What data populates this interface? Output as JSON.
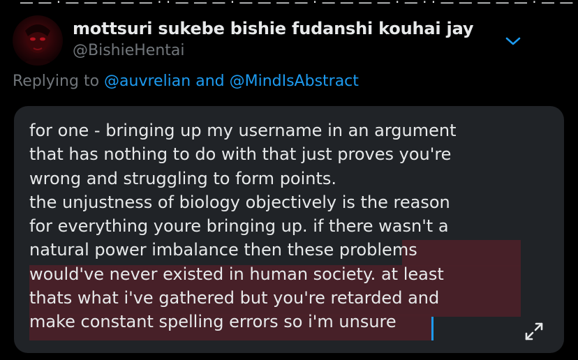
{
  "colors": {
    "background": "#000000",
    "card": "#202327",
    "text": "#e7e9ea",
    "muted": "#71767b",
    "link": "#1d9bf0",
    "highlight": "#4a2128"
  },
  "tweet": {
    "author": {
      "display_name": "mottsuri sukebe bishie fudanshi kouhai jay",
      "handle": "@BishieHentai",
      "avatar_icon": "avatar-image"
    },
    "more_icon": "chevron-down-icon",
    "replying": {
      "prefix": "Replying to ",
      "users": "@auvrelian and @MindIsAbstract"
    },
    "text_lines": [
      "for one - bringing up my username in an argument",
      "that has nothing to do with that just proves you're",
      "wrong and struggling to form points.",
      "the unjustness of biology objectively is the reason",
      "for everything youre bringing up. if there wasn't a",
      "natural power imbalance then these problems",
      "would've never existed in human society. at least",
      "thats what i've gathered but you're retarded and",
      "make constant spelling errors so i'm unsure"
    ],
    "expand_icon": "expand-arrows-icon"
  }
}
